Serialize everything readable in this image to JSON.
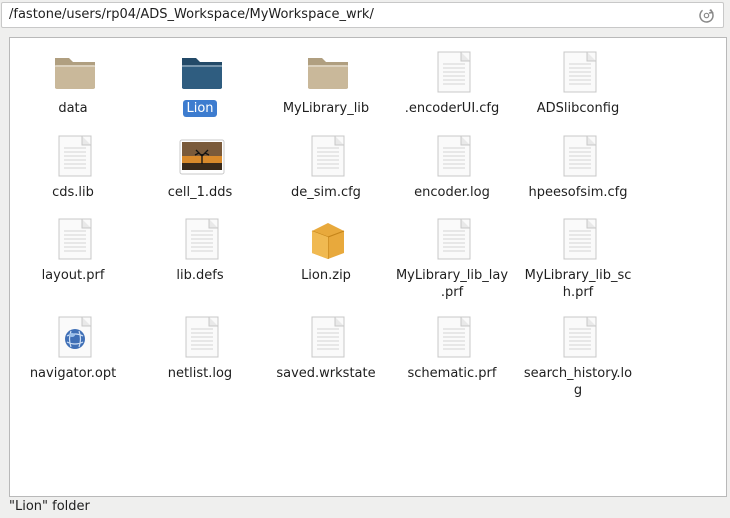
{
  "path": "/fastone/users/rp04/ADS_Workspace/MyWorkspace_wrk/",
  "status": "\"Lion\" folder",
  "files": [
    {
      "name": "data",
      "icon": "folder-icon",
      "selected": false
    },
    {
      "name": "Lion",
      "icon": "folder-icon",
      "selected": true
    },
    {
      "name": "MyLibrary_lib",
      "icon": "folder-icon",
      "selected": false
    },
    {
      "name": ".encoderUI.cfg",
      "icon": "document-icon",
      "selected": false
    },
    {
      "name": "ADSlibconfig",
      "icon": "document-icon",
      "selected": false
    },
    {
      "name": "cds.lib",
      "icon": "document-icon",
      "selected": false
    },
    {
      "name": "cell_1.dds",
      "icon": "image-icon",
      "selected": false
    },
    {
      "name": "de_sim.cfg",
      "icon": "document-icon",
      "selected": false
    },
    {
      "name": "encoder.log",
      "icon": "document-icon",
      "selected": false
    },
    {
      "name": "hpeesofsim.cfg",
      "icon": "document-icon",
      "selected": false
    },
    {
      "name": "layout.prf",
      "icon": "document-icon",
      "selected": false
    },
    {
      "name": "lib.defs",
      "icon": "document-icon",
      "selected": false
    },
    {
      "name": "Lion.zip",
      "icon": "archive-icon",
      "selected": false
    },
    {
      "name": "MyLibrary_lib_lay\n.prf",
      "icon": "document-icon",
      "selected": false
    },
    {
      "name": "MyLibrary_lib_sc\nh.prf",
      "icon": "document-icon",
      "selected": false
    },
    {
      "name": "navigator.opt",
      "icon": "globe-document-icon",
      "selected": false
    },
    {
      "name": "netlist.log",
      "icon": "document-icon",
      "selected": false
    },
    {
      "name": "saved.wrkstate",
      "icon": "document-icon",
      "selected": false
    },
    {
      "name": "schematic.prf",
      "icon": "document-icon",
      "selected": false
    },
    {
      "name": "search_history.lo\ng",
      "icon": "document-icon",
      "selected": false
    }
  ],
  "colors": {
    "folder": "#c9b89a",
    "folder_selected": "#2f5d80",
    "selection": "#3d7ccf"
  }
}
